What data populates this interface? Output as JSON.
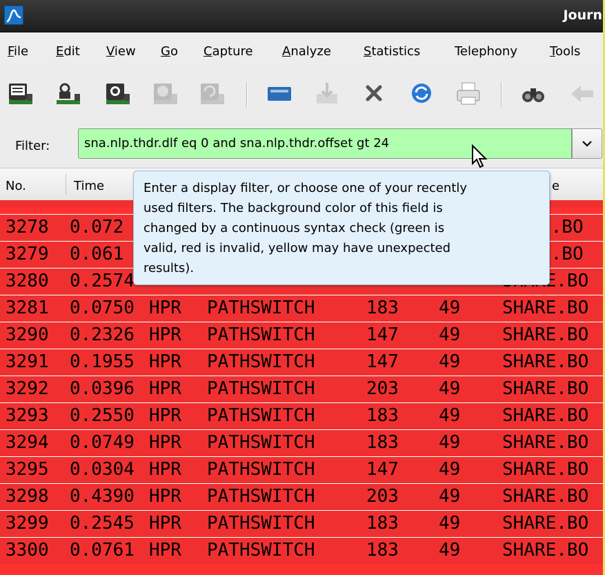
{
  "window": {
    "title": "Journ"
  },
  "menu": [
    {
      "label": "File",
      "u": "F",
      "rest": "ile"
    },
    {
      "label": "Edit",
      "u": "E",
      "rest": "dit"
    },
    {
      "label": "View",
      "u": "V",
      "rest": "iew"
    },
    {
      "label": "Go",
      "u": "G",
      "rest": "o"
    },
    {
      "label": "Capture",
      "u": "C",
      "rest": "apture"
    },
    {
      "label": "Analyze",
      "u": "A",
      "rest": "nalyze"
    },
    {
      "label": "Statistics",
      "u": "S",
      "rest": "tatistics"
    },
    {
      "label": "Telephony",
      "u": "",
      "rest": "Telephony"
    },
    {
      "label": "Tools",
      "u": "T",
      "rest": "ools"
    }
  ],
  "toolbar": {
    "buttons": [
      "interfaces-icon",
      "options-icon",
      "start-capture-icon",
      "stop-capture-icon",
      "restart-capture-icon",
      "open-file-icon",
      "save-file-icon",
      "close-file-icon",
      "reload-icon",
      "print-icon",
      "find-packet-icon",
      "go-back-icon"
    ]
  },
  "filter": {
    "label": "Filter:",
    "value": "sna.nlp.thdr.dlf eq 0 and sna.nlp.thdr.offset gt 24",
    "status_color": "#afffaf"
  },
  "columns": {
    "no": "No.",
    "time": "Time",
    "dest_fragment": "e"
  },
  "tooltip": {
    "line1": "Enter a display filter, or choose one of your recently",
    "line2": "used filters. The background color of this field is",
    "line3": "changed by a continuous syntax check (green is",
    "line4": "valid, red is invalid, yellow may have unexpected",
    "line5": "results)."
  },
  "packets": [
    {
      "no": "3278",
      "time": "0.072",
      "proto": "",
      "info": "",
      "len": "",
      "a": "",
      "dest": "E.BO"
    },
    {
      "no": "3279",
      "time": "0.061",
      "proto": "",
      "info": "",
      "len": "",
      "a": "",
      "dest": "E.BO"
    },
    {
      "no": "3280",
      "time": "0.2574",
      "proto": "",
      "info": "",
      "len": "",
      "a": "",
      "dest": "SHARE.BO"
    },
    {
      "no": "3281",
      "time": "0.0750",
      "proto": "HPR",
      "info": "PATHSWITCH",
      "len": "183",
      "a": "49",
      "dest": "SHARE.BO"
    },
    {
      "no": "3290",
      "time": "0.2326",
      "proto": "HPR",
      "info": "PATHSWITCH",
      "len": "147",
      "a": "49",
      "dest": "SHARE.BO"
    },
    {
      "no": "3291",
      "time": "0.1955",
      "proto": "HPR",
      "info": "PATHSWITCH",
      "len": "147",
      "a": "49",
      "dest": "SHARE.BO"
    },
    {
      "no": "3292",
      "time": "0.0396",
      "proto": "HPR",
      "info": "PATHSWITCH",
      "len": "203",
      "a": "49",
      "dest": "SHARE.BO"
    },
    {
      "no": "3293",
      "time": "0.2550",
      "proto": "HPR",
      "info": "PATHSWITCH",
      "len": "183",
      "a": "49",
      "dest": "SHARE.BO"
    },
    {
      "no": "3294",
      "time": "0.0749",
      "proto": "HPR",
      "info": "PATHSWITCH",
      "len": "183",
      "a": "49",
      "dest": "SHARE.BO"
    },
    {
      "no": "3295",
      "time": "0.0304",
      "proto": "HPR",
      "info": "PATHSWITCH",
      "len": "147",
      "a": "49",
      "dest": "SHARE.BO"
    },
    {
      "no": "3298",
      "time": "0.4390",
      "proto": "HPR",
      "info": "PATHSWITCH",
      "len": "203",
      "a": "49",
      "dest": "SHARE.BO"
    },
    {
      "no": "3299",
      "time": "0.2545",
      "proto": "HPR",
      "info": "PATHSWITCH",
      "len": "183",
      "a": "49",
      "dest": "SHARE.BO"
    }
  ],
  "colors": {
    "row_red": "#f03030",
    "filter_valid": "#afffaf",
    "tooltip_bg": "#e3f1fb"
  }
}
